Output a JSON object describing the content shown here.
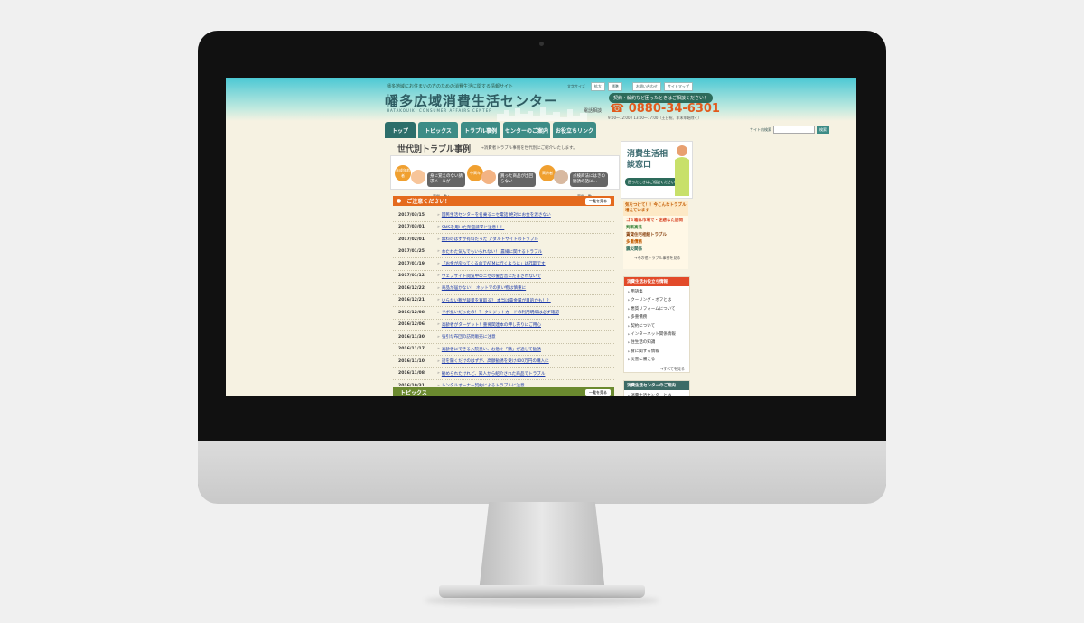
{
  "site": {
    "tagline": "幡多地域にお住まいの方のための消費生活に関する情報サイト",
    "title": "幡多広域消費生活センター",
    "subtitle": "HATAKOUIKI CONSUMER AFFAIRS CENTER",
    "top_buttons": {
      "font_label": "文字サイズ",
      "large": "拡大",
      "standard": "標準",
      "contact": "お問い合わせ",
      "sitemap": "サイトマップ"
    },
    "consult_banner": "契約・解約など困ったときはご相談ください！",
    "tel_label": "電話相談",
    "tel": "0880-34-6301",
    "hours": "9:00〜12:00 / 13:00〜17:00（土日祝、年末年始除く）"
  },
  "nav": {
    "items": [
      "トップ",
      "トピックス",
      "トラブル事例",
      "センターのご案内",
      "お役立ちリンク"
    ],
    "search_label": "サイト内検索",
    "search_button": "検索"
  },
  "generation": {
    "title": "世代別トラブル事例",
    "desc": "→消費者トラブル事例を世代別にご紹介いたします。",
    "groups": [
      {
        "label": "未成年若者",
        "bubble": "身に覚えのない請求メールが",
        "link": "事例一覧へ"
      },
      {
        "label": "中高年",
        "bubble": "買った商品が出回らない",
        "link": ""
      },
      {
        "label": "高齢者",
        "bubble": "点検商法にはきの勧誘の話に…",
        "link": "事例一覧へ"
      }
    ]
  },
  "side_banner": {
    "title": "消費生活相談窓口",
    "sub": "困ったときはご相談ください"
  },
  "caution": {
    "title": "ご注意ください！",
    "more": "一覧を見る",
    "items": [
      {
        "date": "2017/03/15",
        "text": "国民生活センターを名乗るニセ電話 絶対にお金を渡さない"
      },
      {
        "date": "2017/03/01",
        "text": "SMSを用いた架空請求に注意！！"
      },
      {
        "date": "2017/02/01",
        "text": "無料のはずが有料だった アダルトサイトのトラブル"
      },
      {
        "date": "2017/01/25",
        "text": "わたわた気んでもいられない！ 農繊に関するトラブル"
      },
      {
        "date": "2017/01/19",
        "text": "「お金が戻ってくるのでATMに行くように」は詐欺です"
      },
      {
        "date": "2017/01/12",
        "text": "ウェブサイト閲覧中のニセの警告音にだまされないで"
      },
      {
        "date": "2016/12/22",
        "text": "商品が届かない！ ネットでの買い物は慎重に"
      },
      {
        "date": "2016/12/21",
        "text": "いらない靴が裁量を買取る？ 本当は貴金属が目的かも！？"
      },
      {
        "date": "2016/12/08",
        "text": "リボ払いだったの！？ クレジットカードの利用明細は必ず確認"
      },
      {
        "date": "2016/12/06",
        "text": "高齢者がターゲット！重要関連本の押し売りにご用心"
      },
      {
        "date": "2016/11/30",
        "text": "強引な布団の訪問販売に注意"
      },
      {
        "date": "2016/11/17",
        "text": "高齢者にできる入院患い、お急ぐ「購」が通して勧誘"
      },
      {
        "date": "2016/11/10",
        "text": "話を聞くだけのはずが、高額勧誘を受け400万円の購入に"
      },
      {
        "date": "2016/11/08",
        "text": "勧められたけれど、知人から紹介された商品でトラブル"
      },
      {
        "date": "2016/10/31",
        "text": "レンタルオーナー契約によるトラブルに注意"
      }
    ]
  },
  "topics": {
    "title": "トピックス",
    "more": "一覧を見る"
  },
  "notice": {
    "head": "気をつけて！！今こんなトラブル増えています",
    "items": [
      {
        "text": "ゴミ箱は市場で・迷惑なた訪問"
      },
      {
        "text": "判断高法"
      },
      {
        "text": "賃貸住宅相続トラブル"
      },
      {
        "text": "多重債務"
      },
      {
        "text": "震災関係"
      }
    ],
    "more": "→その他トラブル事例を見る"
  },
  "useful": {
    "head": "消費生活お役立ち情報",
    "items": [
      "用語集",
      "クーリング・オフとは",
      "悪質リフォームについて",
      "多重債務",
      "契約について",
      "インターネット関係情報",
      "住生活の知識",
      "食に関する情報",
      "災害に備える"
    ],
    "more": "→すべてを見る"
  },
  "guide": {
    "head": "消費生活センターのご案内",
    "items": [
      "消費生活センターとは"
    ]
  },
  "colors": {
    "nav": "#3d8c86",
    "caution": "#e46a1d",
    "topics": "#6b8a2f",
    "link": "#1d3aa8",
    "tel": "#e25a1c"
  }
}
